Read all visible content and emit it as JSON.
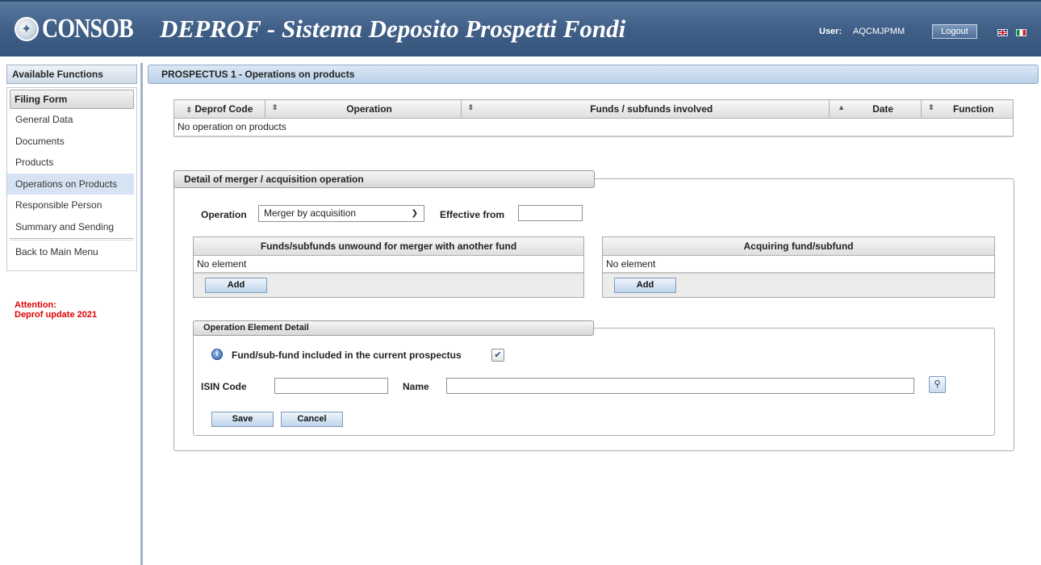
{
  "header": {
    "logo_text": "CONSOB",
    "title": "DEPROF - Sistema Deposito Prospetti Fondi",
    "user_label": "User:",
    "user_value": "AQCMJPMM",
    "logout_label": "Logout"
  },
  "sidebar": {
    "header": "Available Functions",
    "filing_form": "Filing Form",
    "items": [
      {
        "label": "General Data"
      },
      {
        "label": "Documents"
      },
      {
        "label": "Products"
      },
      {
        "label": "Operations on Products"
      },
      {
        "label": "Responsible Person"
      },
      {
        "label": "Summary and Sending"
      }
    ],
    "back_label": "Back to Main Menu",
    "attention_line1": "Attention:",
    "attention_line2": "Deprof update 2021"
  },
  "main": {
    "section_title": "PROSPECTUS 1 - Operations on products",
    "ops_table": {
      "columns": [
        "Deprof Code",
        "Operation",
        "Funds / subfunds involved",
        "Date",
        "Function"
      ],
      "empty_text": "No operation on products"
    },
    "merger": {
      "legend": "Detail of merger / acquisition operation",
      "operation_label": "Operation",
      "operation_value": "Merger by acquisition",
      "effective_label": "Effective from",
      "unwound_table": {
        "header": "Funds/subfunds unwound for merger with another fund",
        "empty_text": "No element",
        "add_label": "Add"
      },
      "acquiring_table": {
        "header": "Acquiring fund/subfund",
        "empty_text": "No element",
        "add_label": "Add"
      }
    },
    "element_detail": {
      "legend": "Operation Element Detail",
      "included_label": "Fund/sub-fund included in the current prospectus",
      "included_checked": true,
      "isin_label": "ISIN Code",
      "name_label": "Name",
      "save_label": "Save",
      "cancel_label": "Cancel"
    }
  }
}
